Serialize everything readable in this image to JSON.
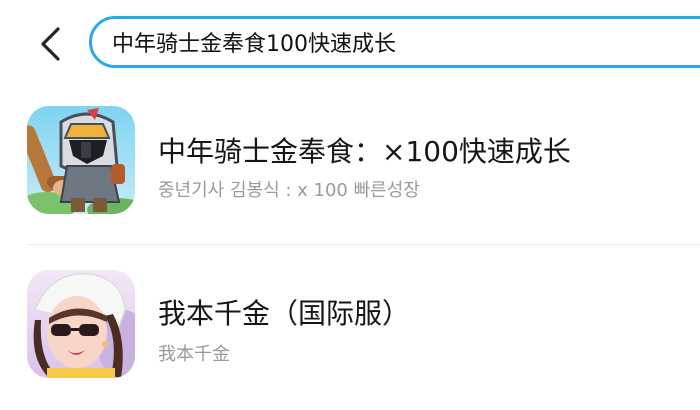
{
  "search": {
    "query": "中年骑士金奉食100快速成长"
  },
  "results": [
    {
      "title": "中年骑士金奉食：×100快速成长",
      "subtitle": "중년기사 김봉식 : x 100 빠른성장",
      "icon": "knight-game-icon"
    },
    {
      "title": "我本千金（国际服）",
      "subtitle": "我本千金",
      "icon": "lady-with-sunglasses-game-icon"
    }
  ],
  "colors": {
    "accent": "#29a9e8",
    "title": "#161616",
    "subtitle": "#9a9a9a",
    "divider": "#e6e6e6"
  }
}
